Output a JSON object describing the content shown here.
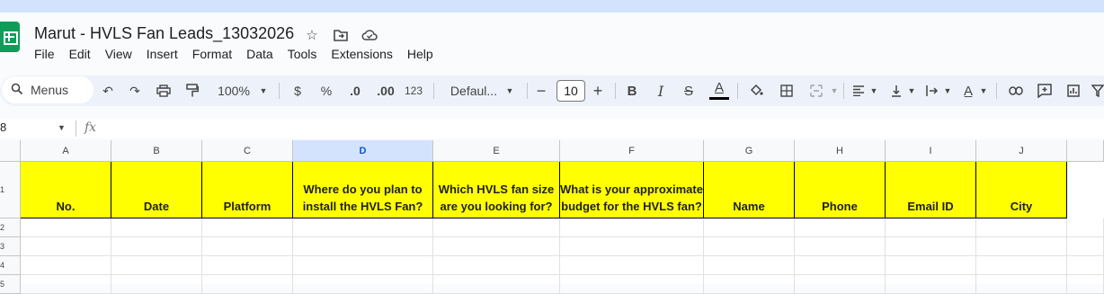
{
  "window": {
    "title": "Marut - HVLS Fan Leads_13032026",
    "title_icons": [
      "star-icon",
      "move-folder-icon",
      "cloud-status-icon"
    ]
  },
  "menu": [
    "File",
    "Edit",
    "View",
    "Insert",
    "Format",
    "Data",
    "Tools",
    "Extensions",
    "Help"
  ],
  "toolbar": {
    "search_label": "Menus",
    "zoom": "100%",
    "currency": "$",
    "percent": "%",
    "decrease_decimal": ".0",
    "increase_decimal": ".00",
    "number_format": "123",
    "font": "Defaul...",
    "font_size": "10",
    "minus": "−",
    "plus": "+",
    "bold": "B",
    "italic": "I",
    "strike": "S",
    "text_color": "A",
    "colors": {
      "accent": "#0b57d0",
      "header_fill": "#ffff00",
      "toolbar_bg": "#edf2fa",
      "top_strip": "#d3e3fd"
    }
  },
  "formula_bar": {
    "cell_ref": "8",
    "fx": "fx",
    "content": ""
  },
  "columns": [
    {
      "letter": "A",
      "header": "No."
    },
    {
      "letter": "B",
      "header": "Date"
    },
    {
      "letter": "C",
      "header": "Platform"
    },
    {
      "letter": "D",
      "header": "Where do you plan to install the HVLS Fan?"
    },
    {
      "letter": "E",
      "header": "Which HVLS fan size are you looking for?"
    },
    {
      "letter": "F",
      "header": "What is your approximate budget for the HVLS fan?"
    },
    {
      "letter": "G",
      "header": "Name"
    },
    {
      "letter": "H",
      "header": "Phone"
    },
    {
      "letter": "I",
      "header": "Email ID"
    },
    {
      "letter": "J",
      "header": "City"
    }
  ],
  "selected_column": "D",
  "rows": [
    "1",
    "2",
    "3",
    "4",
    "5"
  ]
}
